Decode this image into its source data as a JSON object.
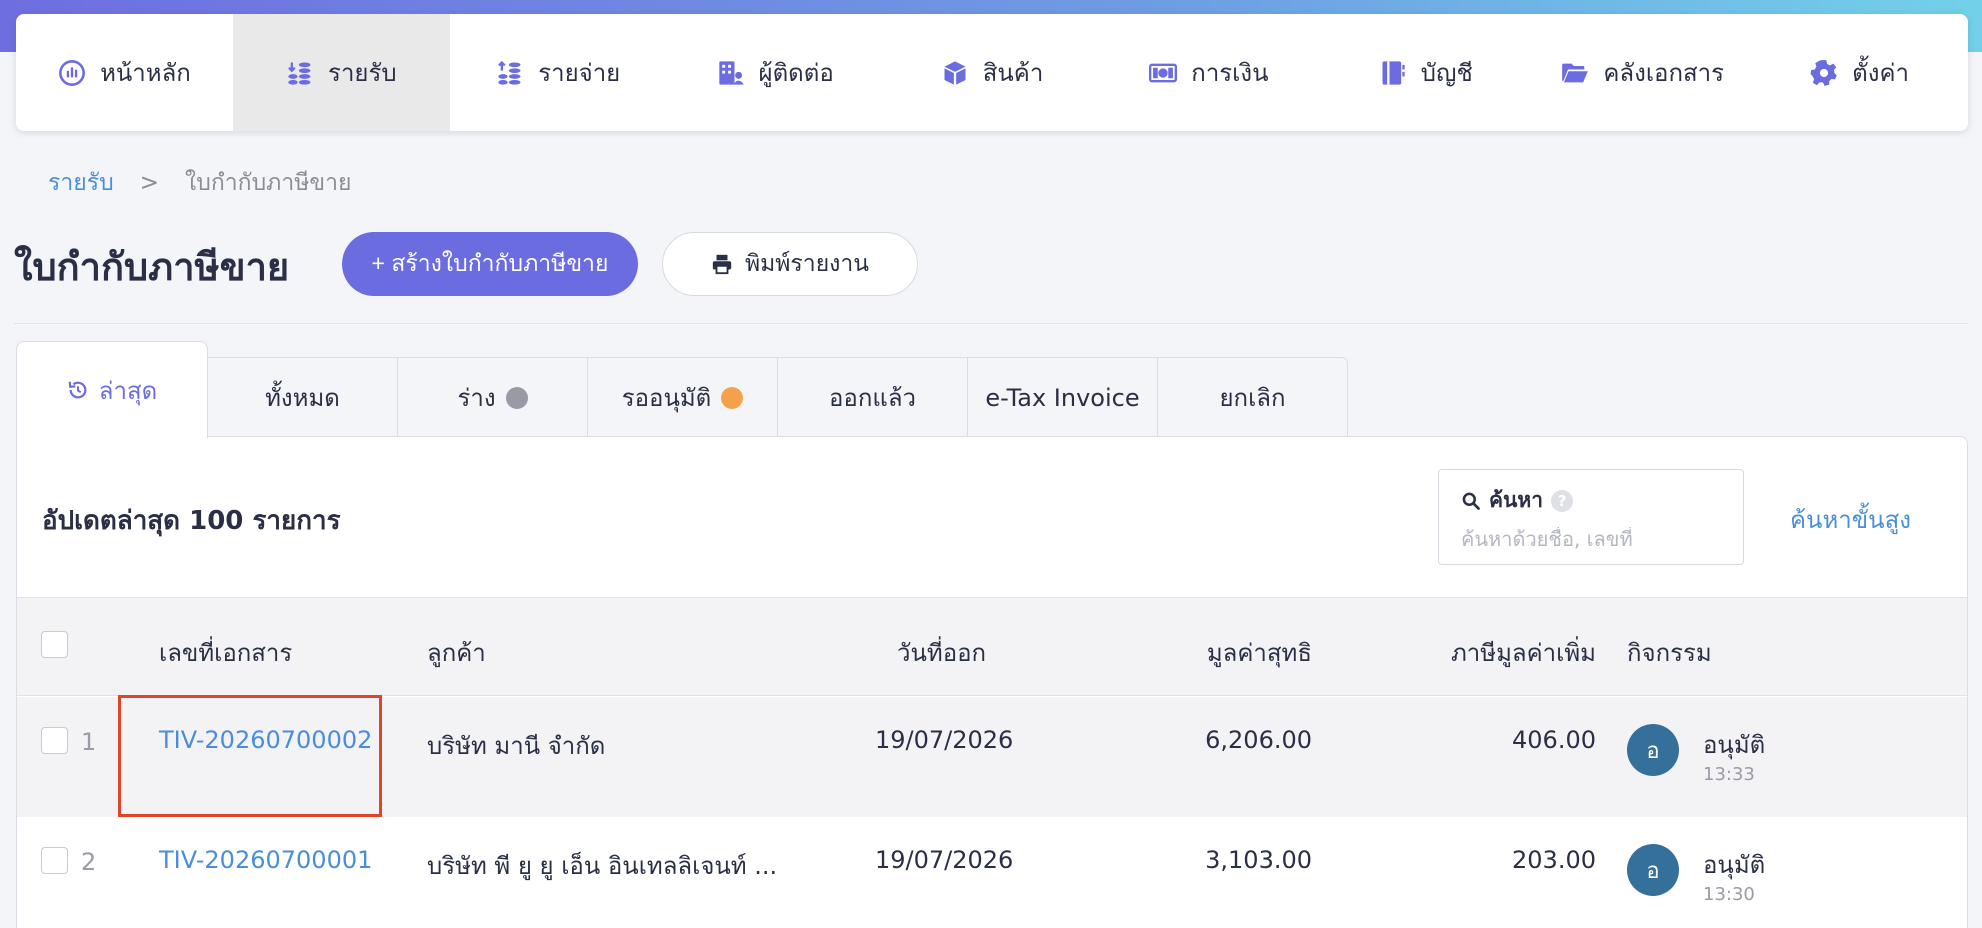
{
  "nav": {
    "items": [
      {
        "label": "หน้าหลัก",
        "icon": "dashboard-icon"
      },
      {
        "label": "รายรับ",
        "icon": "income-icon",
        "active": true
      },
      {
        "label": "รายจ่าย",
        "icon": "expense-icon"
      },
      {
        "label": "ผู้ติดต่อ",
        "icon": "contacts-icon"
      },
      {
        "label": "สินค้า",
        "icon": "box-icon"
      },
      {
        "label": "การเงิน",
        "icon": "money-icon"
      },
      {
        "label": "บัญชี",
        "icon": "ledger-icon"
      },
      {
        "label": "คลังเอกสาร",
        "icon": "folder-icon"
      },
      {
        "label": "ตั้งค่า",
        "icon": "gear-icon"
      }
    ]
  },
  "breadcrumb": {
    "parent": "รายรับ",
    "separator": ">",
    "current": "ใบกำกับภาษีขาย"
  },
  "page": {
    "title": "ใบกำกับภาษีขาย",
    "create_button": "+ สร้างใบกำกับภาษีขาย",
    "print_button": "พิมพ์รายงาน"
  },
  "tabs": [
    {
      "label": "ล่าสุด",
      "icon": "history-icon",
      "active": true
    },
    {
      "label": "ทั้งหมด"
    },
    {
      "label": "ร่าง",
      "dot_color": "#9a9aa6"
    },
    {
      "label": "รออนุมัติ",
      "dot_color": "#f3a14b"
    },
    {
      "label": "ออกแล้ว"
    },
    {
      "label": "e-Tax Invoice"
    },
    {
      "label": "ยกเลิก"
    }
  ],
  "list": {
    "title": "อัปเดตล่าสุด 100 รายการ",
    "search": {
      "label": "ค้นหา",
      "help": "?",
      "placeholder": "ค้นหาด้วยชื่อ, เลขที่"
    },
    "advanced_search": "ค้นหาขั้นสูง"
  },
  "table": {
    "columns": [
      "เลขที่เอกสาร",
      "ลูกค้า",
      "วันที่ออก",
      "มูลค่าสุทธิ",
      "ภาษีมูลค่าเพิ่ม",
      "กิจกรรม"
    ],
    "rows": [
      {
        "index": "1",
        "doc_no": "TIV-20260700002",
        "customer": "บริษัท มานี จำกัด",
        "date": "19/07/2026",
        "net": "6,206.00",
        "vat": "406.00",
        "avatar": "อ",
        "status": "อนุมัติ",
        "time": "13:33"
      },
      {
        "index": "2",
        "doc_no": "TIV-20260700001",
        "customer": "บริษัท พี ยู ยู เอ็น อินเทลลิเจนท์ ...",
        "date": "19/07/2026",
        "net": "3,103.00",
        "vat": "203.00",
        "avatar": "อ",
        "status": "อนุมัติ",
        "time": "13:30"
      }
    ]
  },
  "colors": {
    "accent": "#6b6ce0",
    "link": "#4a8edb",
    "avatar": "#34709a",
    "highlight": "#e0452a"
  }
}
